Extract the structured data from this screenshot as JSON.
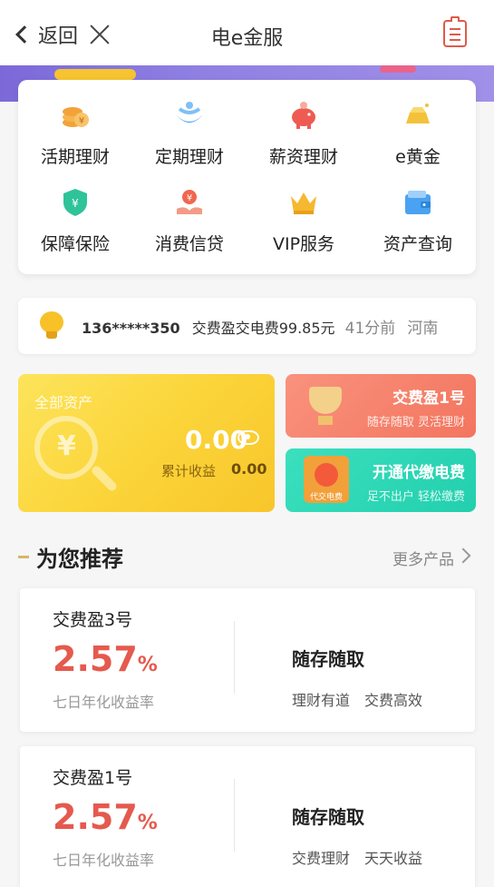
{
  "nav": {
    "back_label": "返回",
    "title": "电e金服"
  },
  "menu": [
    {
      "label": "活期理财",
      "icon": "coin-stack-icon",
      "color": "#f3a23a"
    },
    {
      "label": "定期理财",
      "icon": "wave-bowl-icon",
      "color": "#3b9bf0"
    },
    {
      "label": "薪资理财",
      "icon": "piggy-bank-icon",
      "color": "#ee5b52"
    },
    {
      "label": "e黄金",
      "icon": "gold-bar-icon",
      "color": "#f3c23a"
    },
    {
      "label": "保障保险",
      "icon": "shield-icon",
      "color": "#2fc39a"
    },
    {
      "label": "消费信贷",
      "icon": "hand-coin-icon",
      "color": "#f0674e"
    },
    {
      "label": "VIP服务",
      "icon": "crown-icon",
      "color": "#f5b830"
    },
    {
      "label": "资产查询",
      "icon": "wallet-icon",
      "color": "#4aa2f2"
    }
  ],
  "notice": {
    "phone": "136*****350",
    "text": "交费盈交电费99.85元",
    "time": "41分前",
    "place": "河南"
  },
  "assets": {
    "title": "全部资产",
    "amount": "0.00",
    "earn_label": "累计收益",
    "earn_value": "0.00",
    "currency_symbol": "¥"
  },
  "mini_cards": [
    {
      "title": "交费盈1号",
      "sub": "随存随取  灵活理财"
    },
    {
      "title": "开通代缴电费",
      "sub": "足不出户  轻松缴费",
      "badge": "代交电费"
    }
  ],
  "section": {
    "title": "为您推荐",
    "more": "更多产品"
  },
  "products": [
    {
      "name": "交费盈3号",
      "rate": "2.57",
      "pct": "%",
      "rate_label": "七日年化收益率",
      "feature": "随存随取",
      "tags": [
        "理财有道",
        "交费高效"
      ]
    },
    {
      "name": "交费盈1号",
      "rate": "2.57",
      "pct": "%",
      "rate_label": "七日年化收益率",
      "feature": "随存随取",
      "tags": [
        "交费理财",
        "天天收益"
      ]
    }
  ]
}
